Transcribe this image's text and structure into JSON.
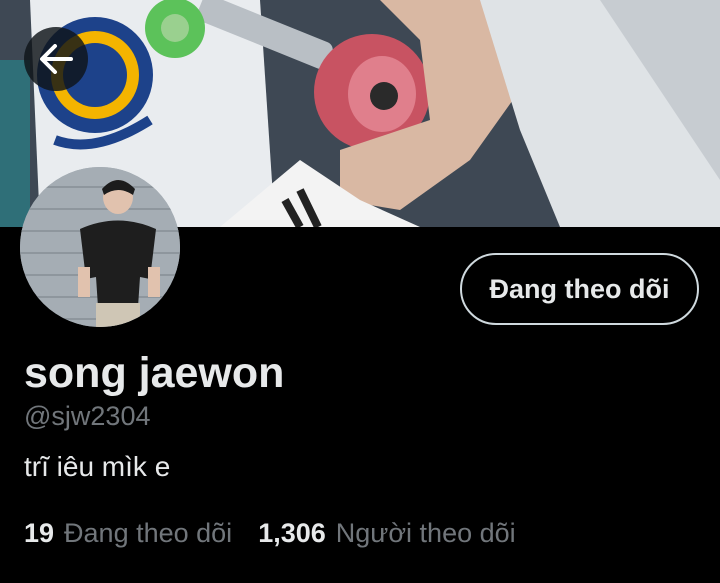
{
  "profile": {
    "display_name": "song jaewon",
    "handle": "@sjw2304",
    "bio": "trĩ iêu mìk e"
  },
  "header": {
    "back_icon": "arrow-left-icon"
  },
  "follow_button": {
    "label": "Đang theo dõi"
  },
  "stats": {
    "following_count": "19",
    "following_label": "Đang theo dõi",
    "followers_count": "1,306",
    "followers_label": "Người theo dõi"
  },
  "colors": {
    "background": "#000000",
    "primary_text": "#e7e9ea",
    "secondary_text": "#71767b",
    "button_border": "#cfd9de"
  }
}
